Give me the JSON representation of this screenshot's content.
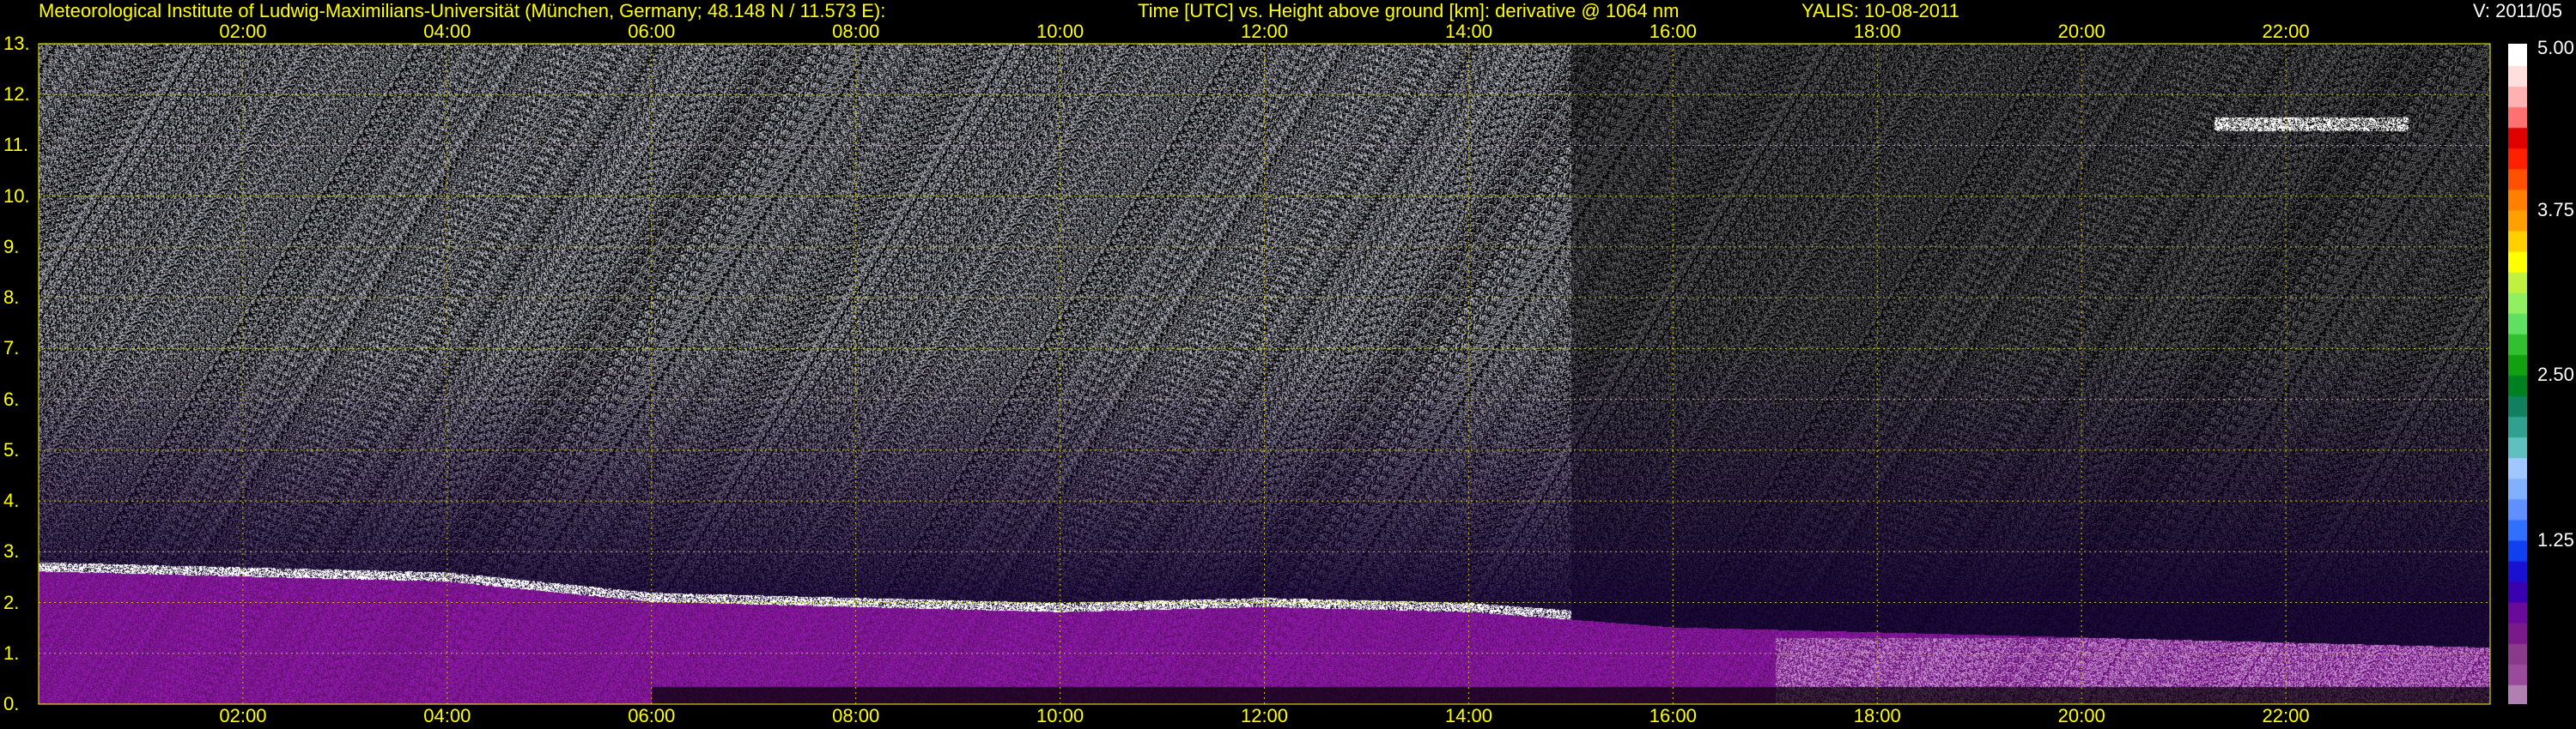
{
  "header": {
    "institute": "Meteorological Institute of Ludwig-Maximilians-Universität (München, Germany; 48.148 N / 11.573 E):",
    "plot_title": "Time [UTC] vs. Height above ground [km]: derivative @ 1064 nm",
    "instrument": "YALIS: 10-08-2011",
    "version": "V: 2011/05"
  },
  "chart_data": {
    "type": "heatmap",
    "title": "Time [UTC] vs. Height above ground [km]: derivative @ 1064 nm",
    "x_ticks": [
      "02:00",
      "04:00",
      "06:00",
      "08:00",
      "10:00",
      "12:00",
      "14:00",
      "16:00",
      "18:00",
      "20:00",
      "22:00"
    ],
    "x_tick_hours": [
      2,
      4,
      6,
      8,
      10,
      12,
      14,
      16,
      18,
      20,
      22
    ],
    "xlim_hours": [
      0,
      24
    ],
    "y_ticks": [
      "0.",
      "1.",
      "2.",
      "3.",
      "4.",
      "5.",
      "6.",
      "7.",
      "8.",
      "9.",
      "10.",
      "11.",
      "12.",
      "13."
    ],
    "y_tick_values": [
      0,
      1,
      2,
      3,
      4,
      5,
      6,
      7,
      8,
      9,
      10,
      11,
      12,
      13
    ],
    "ylim_km": [
      0,
      13
    ],
    "grid": true,
    "colorbar": {
      "ticks": [
        "5.00",
        "3.75",
        "2.50",
        "1.25"
      ],
      "tick_values": [
        5.0,
        3.75,
        2.5,
        1.25
      ],
      "range": [
        0,
        5.0
      ],
      "colors": [
        "#b080b0",
        "#9a4a9a",
        "#8a3a8a",
        "#7a1a8a",
        "#6a0a9a",
        "#3a00b0",
        "#1a10d0",
        "#1040f0",
        "#3070ff",
        "#6090ff",
        "#80b0ff",
        "#a0c8ff",
        "#60c0c0",
        "#30a090",
        "#108060",
        "#008020",
        "#10a010",
        "#30c030",
        "#60e060",
        "#90f060",
        "#c0f040",
        "#ffff00",
        "#ffd000",
        "#ffa000",
        "#ff8000",
        "#ff5000",
        "#ff2000",
        "#e00000",
        "#ff7070",
        "#ffb0b0",
        "#ffdede",
        "#ffffff"
      ]
    },
    "features": [
      {
        "name": "boundary layer aerosol top (approx)",
        "time_hours": [
          0,
          4,
          6,
          8,
          10,
          12,
          14,
          16,
          18,
          20,
          24
        ],
        "height_km": [
          2.7,
          2.5,
          2.1,
          2.0,
          1.9,
          2.0,
          1.9,
          1.6,
          1.5,
          1.4,
          1.2
        ]
      },
      {
        "name": "cirrus layer",
        "time_start": 21.3,
        "time_end": 23.2,
        "height_km": 11.4
      }
    ]
  }
}
